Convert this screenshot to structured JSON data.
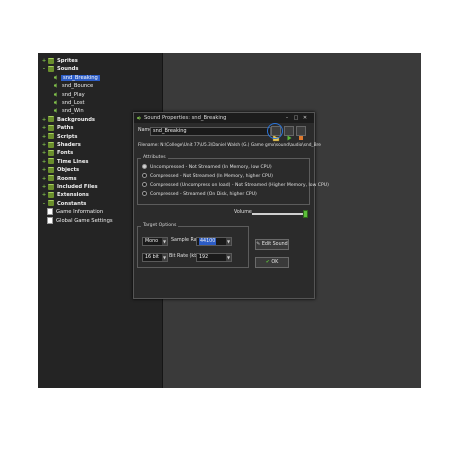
{
  "tree": {
    "items": [
      {
        "label": "Sprites",
        "kind": "group",
        "expander": "+"
      },
      {
        "label": "Sounds",
        "kind": "group",
        "expander": "-"
      },
      {
        "label": "snd_Breaking",
        "kind": "sound"
      },
      {
        "label": "snd_Bounce",
        "kind": "sound"
      },
      {
        "label": "snd_Play",
        "kind": "sound"
      },
      {
        "label": "snd_Lost",
        "kind": "sound"
      },
      {
        "label": "snd_Win",
        "kind": "sound"
      },
      {
        "label": "Backgrounds",
        "kind": "group",
        "expander": "+"
      },
      {
        "label": "Paths",
        "kind": "group",
        "expander": "+"
      },
      {
        "label": "Scripts",
        "kind": "group",
        "expander": "+"
      },
      {
        "label": "Shaders",
        "kind": "group",
        "expander": "+"
      },
      {
        "label": "Fonts",
        "kind": "group",
        "expander": "+"
      },
      {
        "label": "Time Lines",
        "kind": "group",
        "expander": "+"
      },
      {
        "label": "Objects",
        "kind": "group",
        "expander": "+"
      },
      {
        "label": "Rooms",
        "kind": "group",
        "expander": "+"
      },
      {
        "label": "Included Files",
        "kind": "group",
        "expander": "+"
      },
      {
        "label": "Extensions",
        "kind": "group",
        "expander": "+"
      },
      {
        "label": "Constants",
        "kind": "group",
        "expander": "-"
      },
      {
        "label": "Game Information",
        "kind": "doc"
      },
      {
        "label": "Global Game Settings",
        "kind": "doc"
      }
    ],
    "selected": "snd_Breaking"
  },
  "dialog": {
    "title": "Sound Properties: snd_Breaking",
    "name_label": "Name:",
    "name_value": "snd_Breaking",
    "filename": "Filename: N:\\College\\Unit 77\\U5.3\\Daniel Walsh (G.) Game gmx\\sound\\audio\\snd_Bre",
    "attributes": {
      "legend": "Attributes",
      "options": [
        {
          "label": "Uncompressed - Not Streamed (In Memory, low CPU)",
          "selected": true
        },
        {
          "label": "Compressed - Not Streamed (In Memory, higher CPU)",
          "selected": false
        },
        {
          "label": "Compressed (Uncompress on load) - Not Streamed (Higher Memory, low CPU)",
          "selected": false
        },
        {
          "label": "Compressed - Streamed (On Disk, higher CPU)",
          "selected": false
        }
      ]
    },
    "volume": {
      "label": "Volume",
      "level": 1.0
    },
    "target": {
      "legend": "Target Options",
      "channels": "Mono",
      "sample_rate_label": "Sample Rate",
      "sample_rate": "44100",
      "bits": "16 bit",
      "bit_rate_label": "Bit Rate (kbps)",
      "bit_rate": "192"
    },
    "edit_sound_label": "Edit Sound",
    "ok_label": "OK",
    "colors": {
      "accent": "#2c5cc5",
      "ok_green": "#5cbf3a",
      "ring": "#2b74d8"
    }
  }
}
